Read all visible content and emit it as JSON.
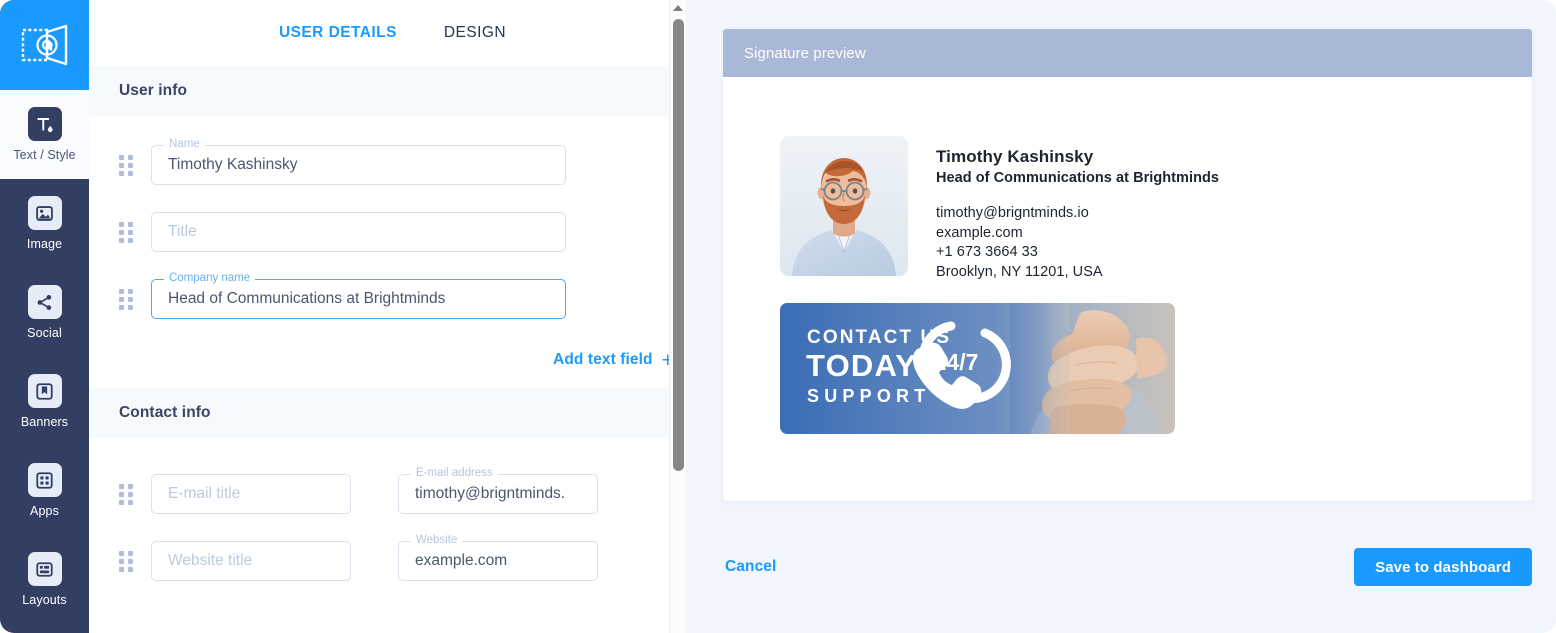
{
  "app": {
    "logo_icon": "email-stamp-logo-icon",
    "accent": "#1a9afe",
    "rail_bg": "#323f63"
  },
  "sidebar": {
    "items": [
      {
        "label": "Text / Style",
        "icon": "text-style-icon",
        "active": true
      },
      {
        "label": "Image",
        "icon": "image-icon",
        "active": false
      },
      {
        "label": "Social",
        "icon": "share-icon",
        "active": false
      },
      {
        "label": "Banners",
        "icon": "bookmark-icon",
        "active": false
      },
      {
        "label": "Apps",
        "icon": "grid-apps-icon",
        "active": false
      },
      {
        "label": "Layouts",
        "icon": "layouts-icon",
        "active": false
      }
    ]
  },
  "tabs": [
    {
      "label": "USER DETAILS",
      "active": true
    },
    {
      "label": "DESIGN",
      "active": false
    }
  ],
  "sections": {
    "user_info_title": "User info",
    "contact_info_title": "Contact info"
  },
  "fields": {
    "name": {
      "legend": "Name",
      "value": "Timothy Kashinsky",
      "placeholder": "Name",
      "focused": false
    },
    "title": {
      "legend": "",
      "value": "",
      "placeholder": "Title",
      "focused": false
    },
    "company": {
      "legend": "Company name",
      "value": "Head of Communications at Brightminds",
      "placeholder": "Company name",
      "focused": true
    },
    "email_title": {
      "legend": "",
      "value": "",
      "placeholder": "E-mail title",
      "focused": false
    },
    "email_address": {
      "legend": "E-mail address",
      "value": "timothy@brigntminds.",
      "placeholder": "E-mail address",
      "focused": false
    },
    "website_title": {
      "legend": "",
      "value": "",
      "placeholder": "Website title",
      "focused": false
    },
    "website": {
      "legend": "Website",
      "value": "example.com",
      "placeholder": "Website",
      "focused": false
    }
  },
  "add_text_field": {
    "label": "Add text field",
    "plus": "+"
  },
  "preview": {
    "header": "Signature preview",
    "signature": {
      "name": "Timothy Kashinsky",
      "role": "Head of Communications at Brightminds",
      "email": "timothy@brigntminds.io",
      "website": "example.com",
      "phone": "+1 673 3664 33",
      "address": "Brooklyn, NY 11201, USA",
      "avatar_alt": "portrait-photo"
    },
    "banner": {
      "line1": "CONTACT US",
      "line2": "TODAY",
      "line3": "SUPPORT",
      "badge": "24/7",
      "icon": "phone-handset-icon"
    }
  },
  "footer": {
    "cancel_label": "Cancel",
    "save_label": "Save to dashboard"
  },
  "scrollbar": {
    "position": "top"
  }
}
